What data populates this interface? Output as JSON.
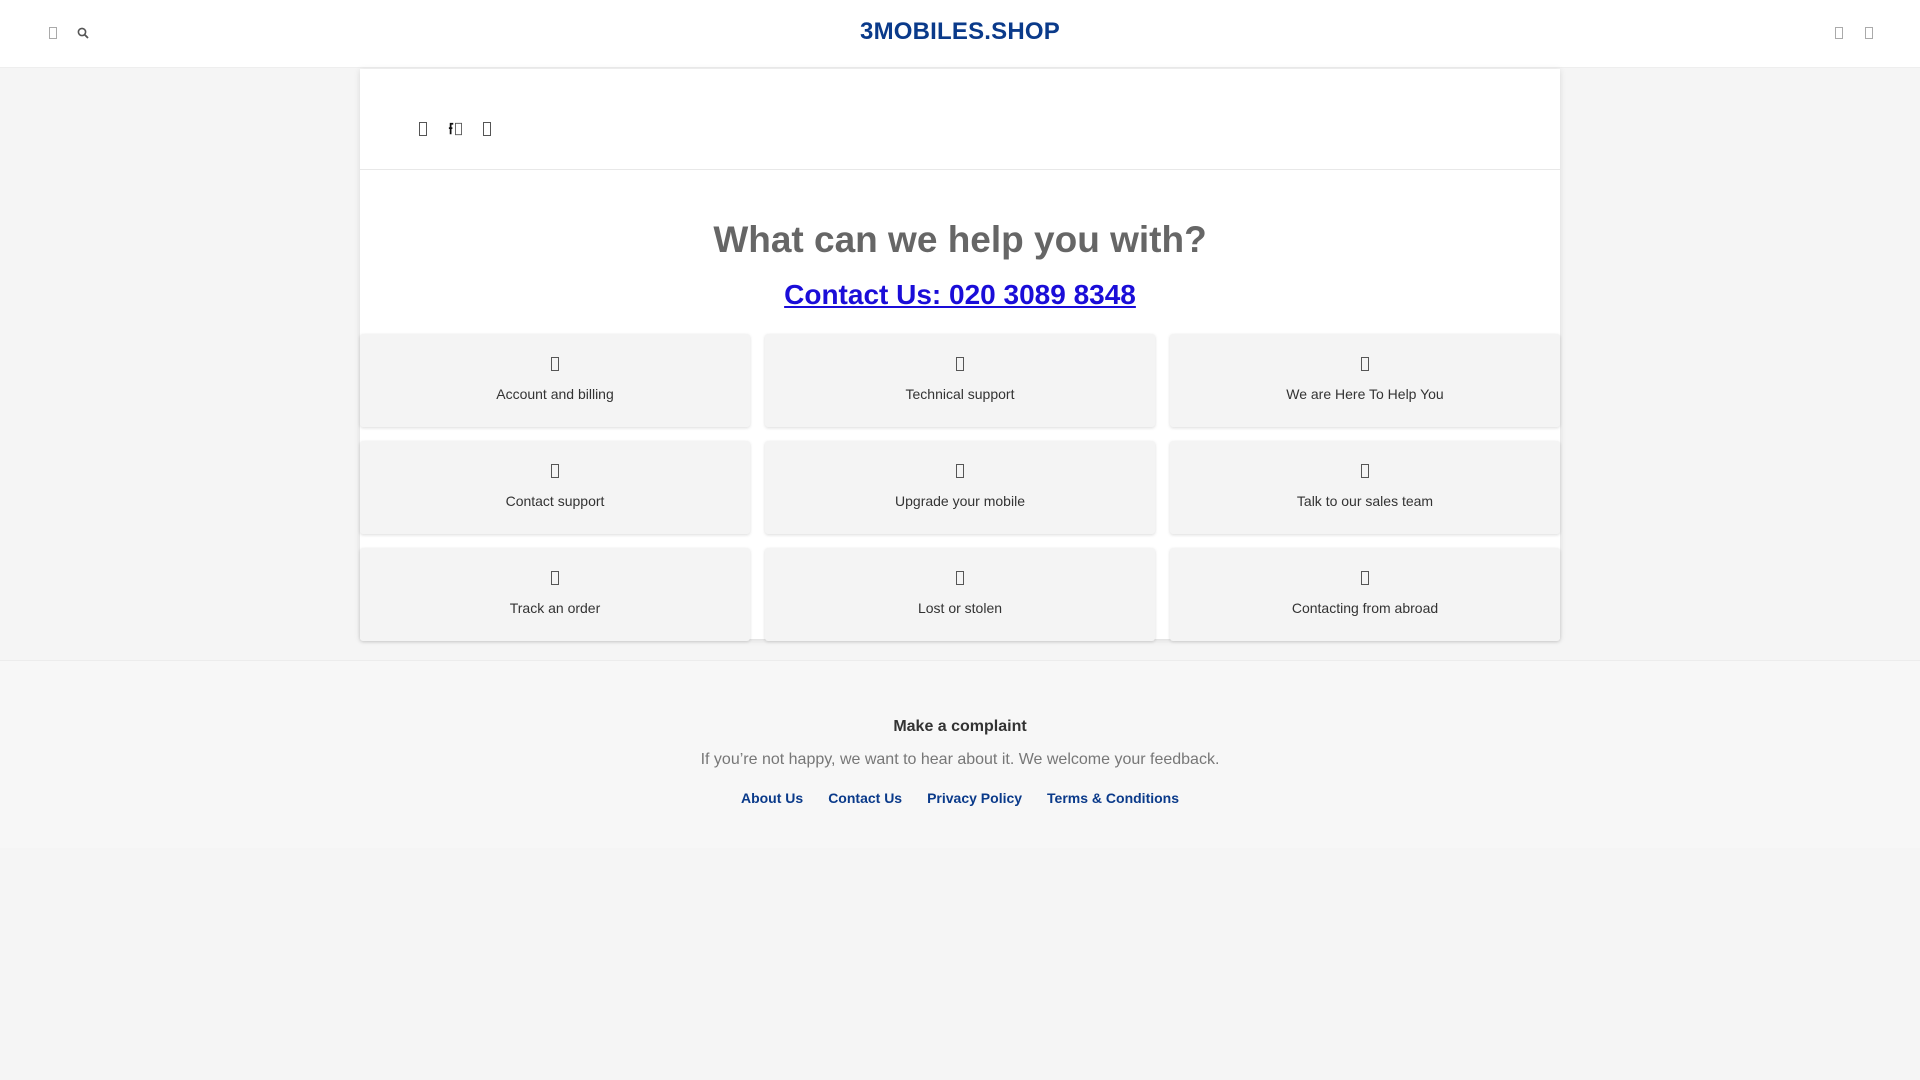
{
  "header": {
    "brand": "3MOBILES.SHOP",
    "left_icons": [
      "menu-icon",
      "search-icon"
    ],
    "right_icons": [
      "user-icon",
      "cart-icon"
    ]
  },
  "toolbar": {
    "icons": [
      "home-icon",
      "search-icon",
      "chevron-icon"
    ]
  },
  "main": {
    "headline": "What can we help you with?",
    "contact": "Contact Us: 020 3089 8348",
    "tiles": [
      {
        "label": "Account and billing",
        "icon": "account-icon"
      },
      {
        "label": "Technical support",
        "icon": "wrench-icon"
      },
      {
        "label": "We are Here To Help You",
        "icon": "help-icon"
      },
      {
        "label": "Contact support",
        "icon": "phone-icon"
      },
      {
        "label": "Upgrade your mobile",
        "icon": "mobile-icon"
      },
      {
        "label": "Talk to our sales team",
        "icon": "chat-icon"
      },
      {
        "label": "Track an order",
        "icon": "truck-icon"
      },
      {
        "label": "Lost or stolen",
        "icon": "lock-icon"
      },
      {
        "label": "Contacting from abroad",
        "icon": "globe-icon"
      }
    ]
  },
  "footer": {
    "complaint_title": "Make a complaint",
    "complaint_text": "If you’re not happy, we want to hear about it. We welcome your feedback.",
    "links": [
      "About Us",
      "Contact Us",
      "Privacy Policy",
      "Terms & Conditions"
    ]
  },
  "colors": {
    "brand": "#0a3a8a",
    "contact_link": "#1a0dd8",
    "tile_bg": "#f4f4f4"
  }
}
